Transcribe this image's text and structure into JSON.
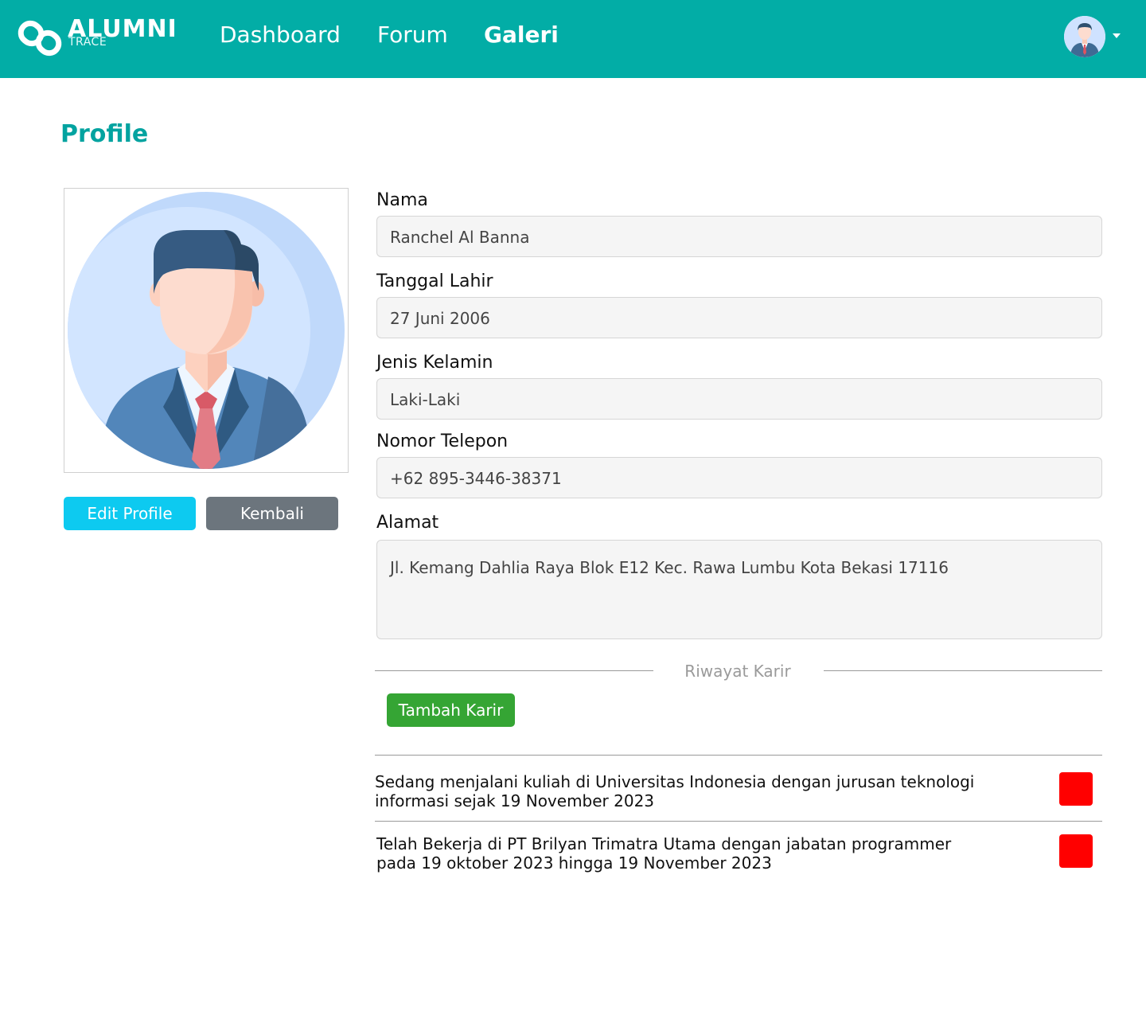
{
  "brand": {
    "title": "ALUMNI",
    "subtitle": "TRACE"
  },
  "nav": {
    "dashboard": "Dashboard",
    "forum": "Forum",
    "galeri": "Galeri"
  },
  "page": {
    "title": "Profile"
  },
  "actions": {
    "edit_label": "Edit Profile",
    "back_label": "Kembali"
  },
  "form": {
    "nama": {
      "label": "Nama",
      "value": "Ranchel Al Banna"
    },
    "tanggal_lahir": {
      "label": "Tanggal Lahir",
      "value": "27 Juni 2006"
    },
    "jenis_kelamin": {
      "label": "Jenis Kelamin",
      "value": "Laki-Laki"
    },
    "telepon": {
      "label": "Nomor Telepon",
      "value": "+62 895-3446-38371"
    },
    "alamat": {
      "label": "Alamat",
      "value": "Jl. Kemang Dahlia Raya Blok E12 Kec. Rawa Lumbu Kota Bekasi 17116"
    }
  },
  "career": {
    "section_title": "Riwayat Karir",
    "add_label": "Tambah Karir",
    "items": [
      {
        "text": "Sedang menjalani kuliah di  Universitas Indonesia  dengan  jurusan  teknologi informasi sejak 19 November 2023"
      },
      {
        "text": "Telah Bekerja di PT Brilyan Trimatra Utama dengan jabatan programmer pada 19 oktober 2023 hingga 19 November 2023"
      }
    ]
  },
  "colors": {
    "navbar": "#02ada6",
    "title": "#02a3a0",
    "edit_button": "#0dcaf0",
    "back_button": "#6c757d",
    "add_button": "#35a534",
    "delete_button": "#ff0000"
  },
  "icons": {
    "logo": "chain-link-icon",
    "user_menu": "chevron-down-icon",
    "avatar": "businessman-avatar"
  }
}
